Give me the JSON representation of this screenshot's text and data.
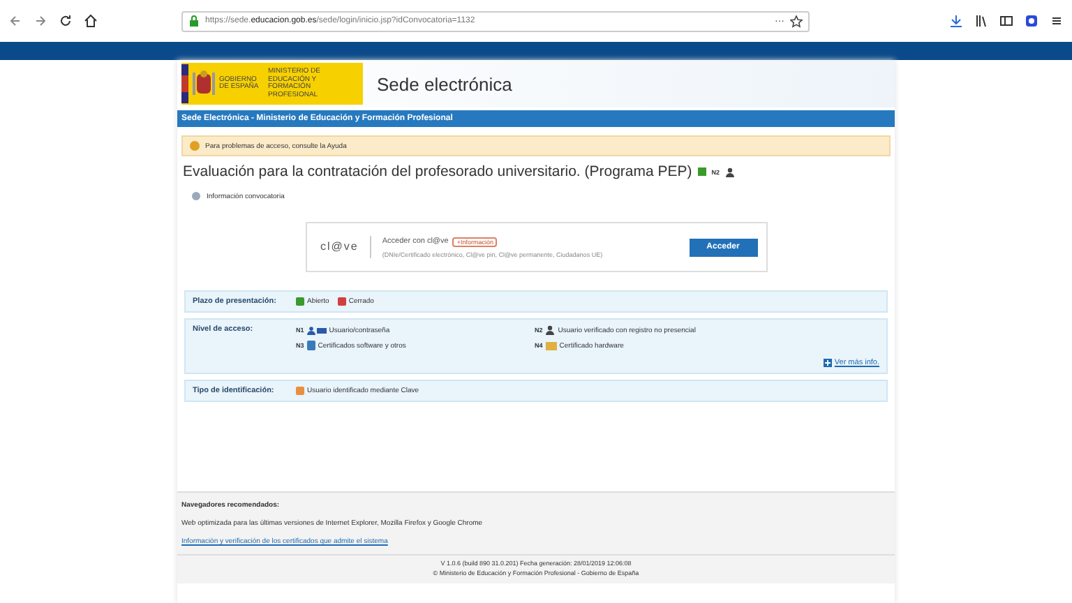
{
  "browser": {
    "url_prefix": "https://sede.",
    "url_domain": "educacion.gob.es",
    "url_rest": "/sede/login/inicio.jsp?idConvocatoria=1132",
    "menu": "···"
  },
  "header": {
    "gov": "GOBIERNO DE ESPAÑA",
    "ministry": "MINISTERIO DE EDUCACIÓN Y FORMACIÓN PROFESIONAL",
    "title": "Sede electrónica"
  },
  "breadcrumb": "Sede Electrónica - Ministerio de Educación y Formación Profesional",
  "notice": "Para problemas de acceso, consulte la Ayuda",
  "page_title": "Evaluación para la contratación del profesorado universitario. (Programa PEP)",
  "title_level": "N2",
  "info_link": "Información convocatoria",
  "login": {
    "logo": "cl@ve",
    "heading": "Acceder con cl@ve",
    "info_badge": "+Información",
    "methods": "(DNIe/Certificado electrónico, Cl@ve pin, Cl@ve permanente, Ciudadanos UE)",
    "button": "Acceder"
  },
  "panels": [
    {
      "label": "Plazo de presentación:",
      "items": [
        {
          "kind": "status",
          "text": "Abierto",
          "color": "#3a9a2a"
        },
        {
          "kind": "status",
          "text": "Cerrado",
          "color": "#d04040"
        }
      ]
    },
    {
      "label": "Nivel de acceso:",
      "items": [
        {
          "kind": "level",
          "code": "N1",
          "text": "Usuario/contraseña"
        },
        {
          "kind": "level",
          "code": "N2",
          "text": "Usuario verificado con registro no presencial"
        },
        {
          "kind": "level",
          "code": "N3",
          "text": "Certificados software y otros"
        },
        {
          "kind": "level",
          "code": "N4",
          "text": "Certificado hardware"
        }
      ],
      "more": "Ver más info."
    },
    {
      "label": "Tipo de identificación:",
      "items": [
        {
          "kind": "id",
          "text": "Usuario identificado mediante Clave",
          "color": "#e89040"
        }
      ]
    }
  ],
  "footer": {
    "heading": "Navegadores recomendados:",
    "text": "Web optimizada para las últimas versiones de Internet Explorer, Mozilla Firefox y Google Chrome",
    "link": "Información y verificación de los certificados que admite el sistema",
    "version": "V 1.0.6 (build 890 31.0.201) Fecha generación: 28/01/2019 12:06:08",
    "copyright": "© Ministerio de Educación y Formación Profesional - Gobierno de España"
  }
}
